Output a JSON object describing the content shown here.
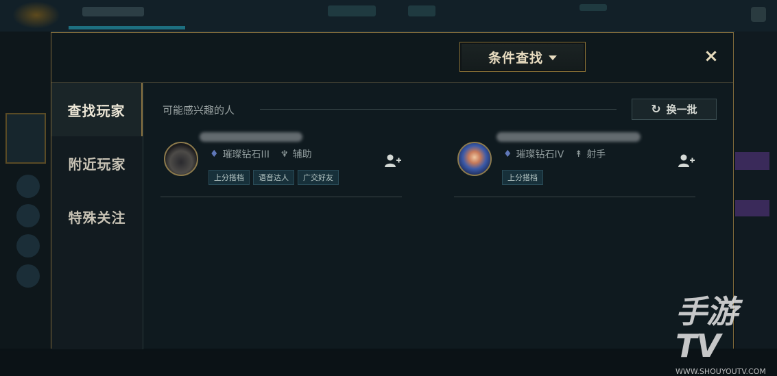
{
  "modal": {
    "filter_button": "条件查找",
    "close_label": "×"
  },
  "sidebar": {
    "items": [
      {
        "label": "查找玩家",
        "active": true
      },
      {
        "label": "附近玩家",
        "active": false
      },
      {
        "label": "特殊关注",
        "active": false
      }
    ]
  },
  "recommend": {
    "title": "可能感兴趣的人",
    "refresh_label": "换一批"
  },
  "players": [
    {
      "rank": "璀璨钻石III",
      "role": "辅助",
      "role_icon": "support-icon",
      "tags": [
        "上分搭档",
        "语音达人",
        "广交好友"
      ]
    },
    {
      "rank": "璀璨钻石IV",
      "role": "射手",
      "role_icon": "marksman-icon",
      "tags": [
        "上分搭档"
      ]
    }
  ],
  "watermark": {
    "logo": "手游TV",
    "url": "WWW.SHOUYOUTV.COM"
  },
  "colors": {
    "gold_border": "#806a3b",
    "panel_bg": "#0f1a1f",
    "tag_bg": "#17303a"
  }
}
